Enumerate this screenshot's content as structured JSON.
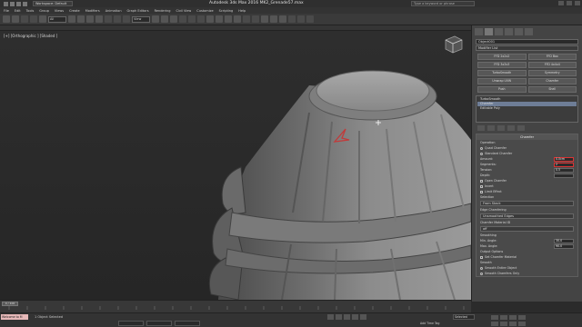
{
  "titlebar": {
    "workspace": "Workspace: Default",
    "title": "Autodesk 3ds Max 2016     MK2_Grenade57.max",
    "search_placeholder": "Type a keyword or phrase"
  },
  "menus": [
    "File",
    "Edit",
    "Tools",
    "Group",
    "Views",
    "Create",
    "Modifiers",
    "Animation",
    "Graph Editors",
    "Rendering",
    "Civil View",
    "Customize",
    "Scripting",
    "Help"
  ],
  "toolbar": {
    "filter": "All",
    "refcoord": "View"
  },
  "viewport": {
    "label": "[+] [Orthographic ] [Shaded ]"
  },
  "command_panel": {
    "object_name": "Object001",
    "modifier_list": "Modifier List",
    "modifier_buttons": [
      "FFD 2x2x2",
      "FFD Box",
      "FFD 3x3x3",
      "FFD 4x4x4",
      "TurboSmooth",
      "Symmetry",
      "Unwrap UVW",
      "Chamfer",
      "Push",
      "Shell"
    ],
    "stack": [
      "TurboSmooth",
      "Chamfer",
      "Editable Poly"
    ],
    "chamfer": {
      "header": "Chamfer",
      "operation_label": "Operation",
      "quad": "Quad Chamfer",
      "standard": "Standard Chamfer",
      "amount_label": "Amount:",
      "amount_value": "0.0cm",
      "segments_label": "Segments:",
      "segments_value": "2",
      "tension_label": "Tension:",
      "tension_value": "0.5",
      "depth_label": "Depth:",
      "open_chamfer": "Open Chamfer",
      "invert": "Invert",
      "use_minor": "Limit Effect",
      "selection_label": "Selection",
      "selection_value": "From Stack",
      "edge_chamfer_label": "Edge Chamfering",
      "edge_chamfer_value": "Unsmoothed Edges",
      "material_label": "Chamfer Material ID",
      "material_value": "off",
      "smoothing_label": "Smoothing",
      "min_angle_label": "Min. Angle:",
      "min_angle_value": "30.0",
      "max_angle_label": "Max. Angle:",
      "max_angle_value": "90.0",
      "output_label": "Output Options",
      "output_value": "Set Chamfer Material",
      "smooth_label": "Smooth",
      "smooth_opt1": "Smooth Entire Object",
      "smooth_opt2": "Smooth Chamfers Only"
    }
  },
  "timeline": {
    "slider": "0 / 100"
  },
  "status": {
    "maxscript": "Welcome to M",
    "selected_text": "1 Object Selected",
    "autokey": "Add Time Tag",
    "selected_dd": "Selected"
  },
  "colors": {
    "highlight": "#6e7d96",
    "annotation_arrow": "#c23a3a",
    "amount_highlight": "#dd3333"
  }
}
